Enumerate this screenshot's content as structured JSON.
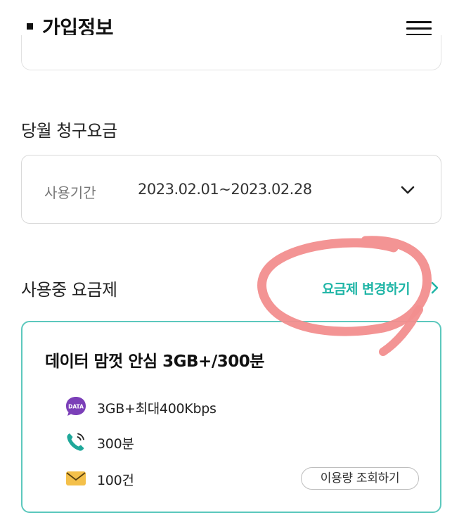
{
  "header": {
    "title": "가입정보"
  },
  "billing": {
    "section_title": "당월 청구요금",
    "period_label": "사용기간",
    "period_value": "2023.02.01~2023.02.28"
  },
  "plan": {
    "section_title": "사용중 요금제",
    "change_link": "요금제 변경하기",
    "name": "데이터 맘껏 안심 3GB+/300분",
    "data_icon_text": "DATA",
    "features": [
      {
        "icon": "data-icon",
        "text": "3GB+최대400Kbps"
      },
      {
        "icon": "phone-icon",
        "text": "300분"
      },
      {
        "icon": "message-icon",
        "text": "100건"
      }
    ],
    "usage_button": "이용량 조회하기"
  },
  "colors": {
    "accent": "#1fb5a6",
    "card_border": "#5cc8bd",
    "data_icon": "#7b3fb8",
    "phone_icon": "#1fa89a",
    "message_icon": "#f4c04a",
    "annotation_stroke": "#f28e8e"
  }
}
